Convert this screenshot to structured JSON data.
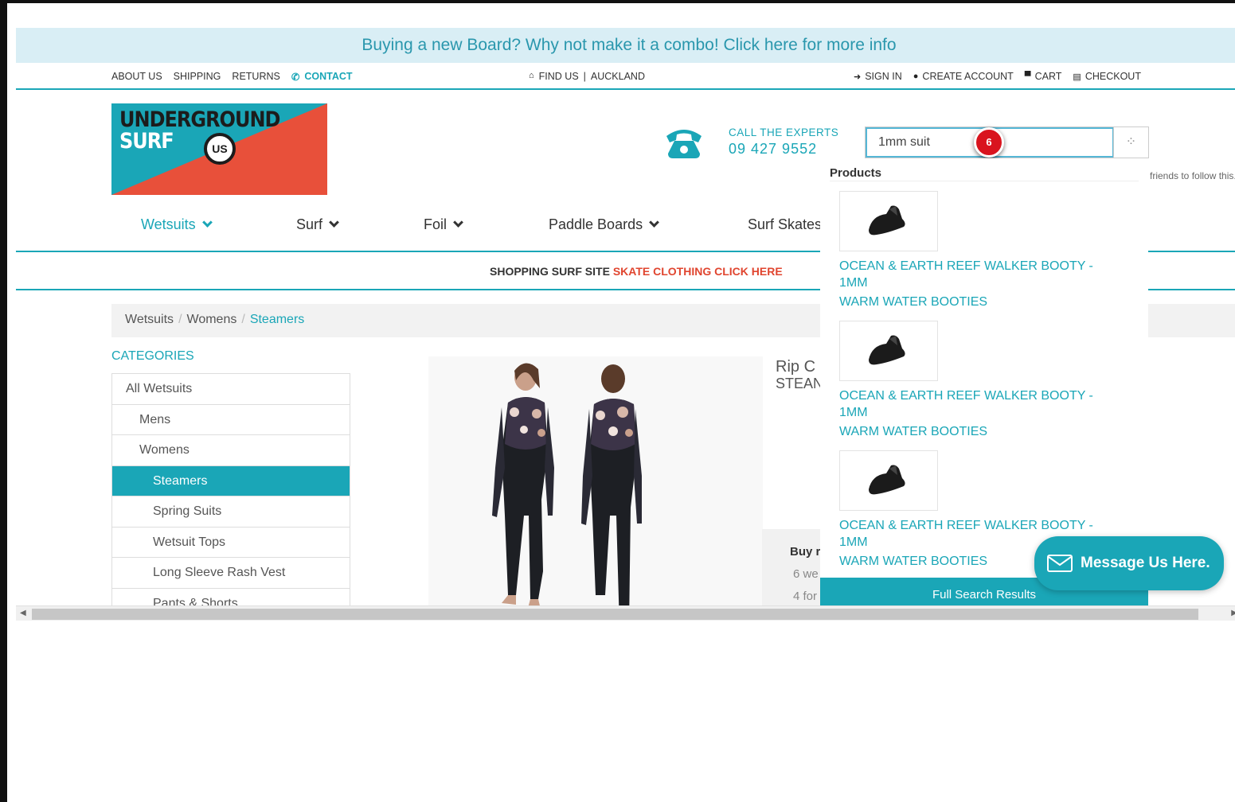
{
  "promo": {
    "text": "Buying a new Board? Why not make it a combo! Click here for more info"
  },
  "topbar": {
    "left": [
      "ABOUT US",
      "SHIPPING",
      "RETURNS"
    ],
    "contact": "CONTACT",
    "find_us": "FIND US",
    "divider": "|",
    "location": "AUCKLAND",
    "sign_in": "SIGN IN",
    "create_account": "CREATE ACCOUNT",
    "cart": "CART",
    "checkout": "CHECKOUT"
  },
  "logo": {
    "line1": "UNDERGROUND",
    "line2": "SURF",
    "badge": "US",
    "colors": {
      "teal": "#1aa6b7",
      "red": "#e8503a"
    }
  },
  "call": {
    "label": "CALL  THE  EXPERTS",
    "number": "09  427  9552"
  },
  "search": {
    "value": "1mm suit",
    "spinner_icon": "loading-spinner-icon"
  },
  "step_marker": "6",
  "nav": {
    "items": [
      "Wetsuits",
      "Surf",
      "Foil",
      "Paddle Boards",
      "Surf Skates"
    ]
  },
  "subbar": {
    "lead": "SHOPPING SURF SITE",
    "link": "SKATE CLOTHING CLICK HERE"
  },
  "breadcrumb": {
    "items": [
      "Wetsuits",
      "Womens",
      "Steamers"
    ],
    "separator": "/"
  },
  "categories": {
    "title": "CATEGORIES",
    "items": [
      "All Wetsuits",
      "Mens",
      "Womens",
      "Steamers",
      "Spring Suits",
      "Wetsuit Tops",
      "Long Sleeve Rash Vest",
      "Pants & Shorts"
    ],
    "active": "Steamers"
  },
  "product": {
    "title_partial_1": "Rip C",
    "title_partial_2": "STEAN",
    "buy_partial": "Buy r",
    "buy_line2": "6 we",
    "buy_line3": "4 for"
  },
  "search_dropdown": {
    "heading": "Products",
    "results": [
      {
        "name_line1": "OCEAN & EARTH REEF WALKER BOOTY -",
        "name_line2": "1MM",
        "category": "WARM WATER BOOTIES"
      },
      {
        "name_line1": "OCEAN & EARTH REEF WALKER BOOTY -",
        "name_line2": "1MM",
        "category": "WARM WATER BOOTIES"
      },
      {
        "name_line1": "OCEAN & EARTH REEF WALKER BOOTY -",
        "name_line2": "1MM",
        "category": "WARM WATER BOOTIES"
      }
    ],
    "full_results": "Full Search Results"
  },
  "friends_text": "friends to follow this.",
  "chat": {
    "label": "Message Us Here."
  }
}
